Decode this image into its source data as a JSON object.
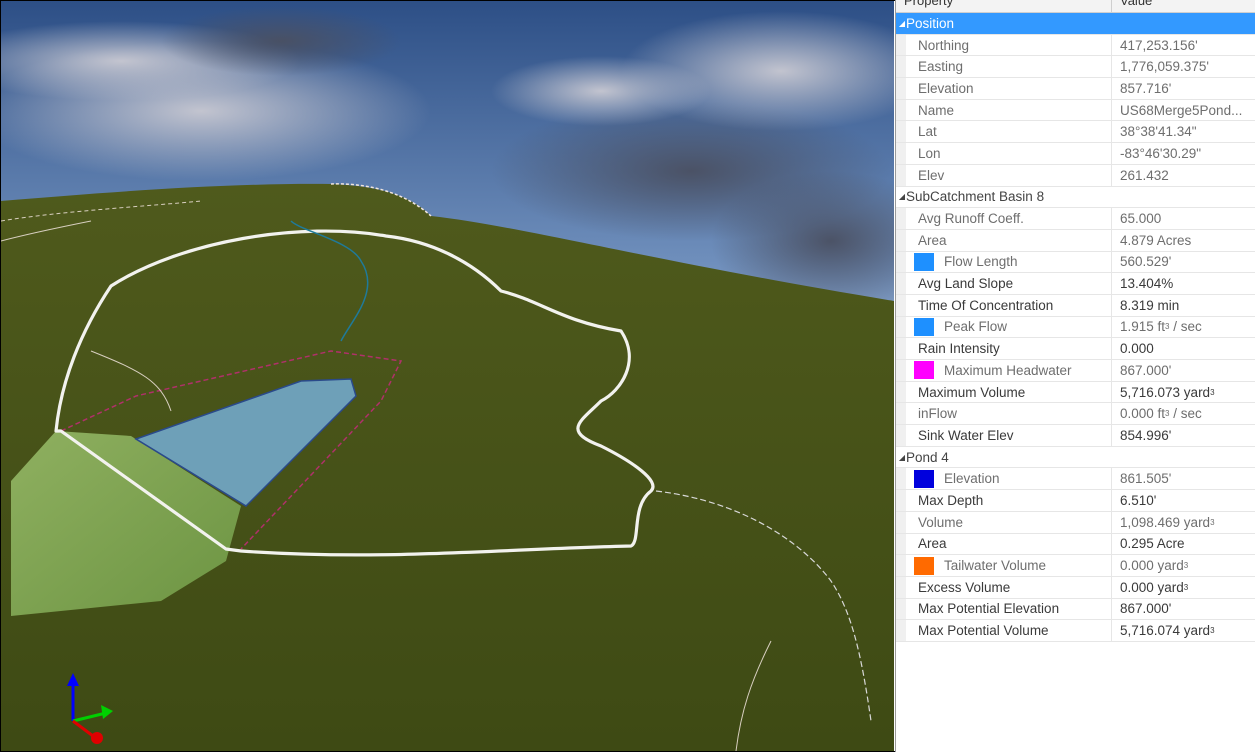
{
  "grid": {
    "header": {
      "property": "Property",
      "value": "Value"
    },
    "sections": [
      {
        "title": "Position",
        "selected": true,
        "rows": [
          {
            "name": "Northing",
            "value": "417,253.156'"
          },
          {
            "name": "Easting",
            "value": "1,776,059.375'"
          },
          {
            "name": "Elevation",
            "value": "857.716'"
          },
          {
            "name": "Name",
            "value": "US68Merge5Pond..."
          },
          {
            "name": "Lat",
            "value": "38°38'41.34\""
          },
          {
            "name": "Lon",
            "value": "-83°46'30.29\""
          },
          {
            "name": "Elev",
            "value": "261.432"
          }
        ]
      },
      {
        "title": "SubCatchment Basin 8",
        "rows": [
          {
            "name": "Avg Runoff Coeff.",
            "value": "65.000"
          },
          {
            "name": "Area",
            "value": "4.879 Acres"
          },
          {
            "name": "Flow Length",
            "value": "560.529'",
            "swatch": "#1e90ff"
          },
          {
            "name": "Avg Land Slope",
            "value": "13.404%",
            "dark": true
          },
          {
            "name": "Time Of Concentration",
            "value": "8.319 min",
            "dark": true
          },
          {
            "name": "Peak Flow",
            "value": "1.915 ft",
            "sup": "3",
            "suffix": " / sec",
            "swatch": "#1e90ff"
          },
          {
            "name": "Rain Intensity",
            "value": "0.000",
            "dark": true
          },
          {
            "name": "Maximum Headwater",
            "value": "867.000'",
            "swatch": "#ff00ff"
          },
          {
            "name": "Maximum Volume",
            "value": "5,716.073 yard",
            "sup": "3",
            "dark": true
          },
          {
            "name": "inFlow",
            "value": "0.000 ft",
            "sup": "3",
            "suffix": " / sec"
          },
          {
            "name": "Sink Water Elev",
            "value": "854.996'",
            "dark": true
          }
        ]
      },
      {
        "title": "Pond 4",
        "rows": [
          {
            "name": "Elevation",
            "value": "861.505'",
            "swatch": "#0000dd"
          },
          {
            "name": "Max Depth",
            "value": "6.510'",
            "dark": true
          },
          {
            "name": "Volume",
            "value": "1,098.469 yard",
            "sup": "3"
          },
          {
            "name": "Area",
            "value": "0.295 Acre",
            "dark": true
          },
          {
            "name": "Tailwater Volume",
            "value": "0.000 yard",
            "sup": "3",
            "swatch": "#ff6a00"
          },
          {
            "name": "Excess Volume",
            "value": "0.000 yard",
            "sup": "3",
            "dark": true
          },
          {
            "name": "Max Potential Elevation",
            "value": "867.000'",
            "dark": true
          },
          {
            "name": "Max Potential Volume",
            "value": "5,716.074 yard",
            "sup": "3",
            "dark": true
          }
        ]
      }
    ]
  }
}
